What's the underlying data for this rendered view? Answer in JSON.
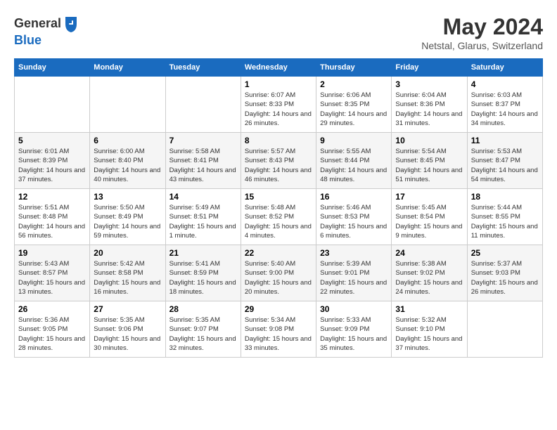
{
  "header": {
    "logo_line1": "General",
    "logo_line2": "Blue",
    "month": "May 2024",
    "location": "Netstal, Glarus, Switzerland"
  },
  "weekdays": [
    "Sunday",
    "Monday",
    "Tuesday",
    "Wednesday",
    "Thursday",
    "Friday",
    "Saturday"
  ],
  "weeks": [
    [
      {
        "day": "",
        "sunrise": "",
        "sunset": "",
        "daylight": ""
      },
      {
        "day": "",
        "sunrise": "",
        "sunset": "",
        "daylight": ""
      },
      {
        "day": "",
        "sunrise": "",
        "sunset": "",
        "daylight": ""
      },
      {
        "day": "1",
        "sunrise": "Sunrise: 6:07 AM",
        "sunset": "Sunset: 8:33 PM",
        "daylight": "Daylight: 14 hours and 26 minutes."
      },
      {
        "day": "2",
        "sunrise": "Sunrise: 6:06 AM",
        "sunset": "Sunset: 8:35 PM",
        "daylight": "Daylight: 14 hours and 29 minutes."
      },
      {
        "day": "3",
        "sunrise": "Sunrise: 6:04 AM",
        "sunset": "Sunset: 8:36 PM",
        "daylight": "Daylight: 14 hours and 31 minutes."
      },
      {
        "day": "4",
        "sunrise": "Sunrise: 6:03 AM",
        "sunset": "Sunset: 8:37 PM",
        "daylight": "Daylight: 14 hours and 34 minutes."
      }
    ],
    [
      {
        "day": "5",
        "sunrise": "Sunrise: 6:01 AM",
        "sunset": "Sunset: 8:39 PM",
        "daylight": "Daylight: 14 hours and 37 minutes."
      },
      {
        "day": "6",
        "sunrise": "Sunrise: 6:00 AM",
        "sunset": "Sunset: 8:40 PM",
        "daylight": "Daylight: 14 hours and 40 minutes."
      },
      {
        "day": "7",
        "sunrise": "Sunrise: 5:58 AM",
        "sunset": "Sunset: 8:41 PM",
        "daylight": "Daylight: 14 hours and 43 minutes."
      },
      {
        "day": "8",
        "sunrise": "Sunrise: 5:57 AM",
        "sunset": "Sunset: 8:43 PM",
        "daylight": "Daylight: 14 hours and 46 minutes."
      },
      {
        "day": "9",
        "sunrise": "Sunrise: 5:55 AM",
        "sunset": "Sunset: 8:44 PM",
        "daylight": "Daylight: 14 hours and 48 minutes."
      },
      {
        "day": "10",
        "sunrise": "Sunrise: 5:54 AM",
        "sunset": "Sunset: 8:45 PM",
        "daylight": "Daylight: 14 hours and 51 minutes."
      },
      {
        "day": "11",
        "sunrise": "Sunrise: 5:53 AM",
        "sunset": "Sunset: 8:47 PM",
        "daylight": "Daylight: 14 hours and 54 minutes."
      }
    ],
    [
      {
        "day": "12",
        "sunrise": "Sunrise: 5:51 AM",
        "sunset": "Sunset: 8:48 PM",
        "daylight": "Daylight: 14 hours and 56 minutes."
      },
      {
        "day": "13",
        "sunrise": "Sunrise: 5:50 AM",
        "sunset": "Sunset: 8:49 PM",
        "daylight": "Daylight: 14 hours and 59 minutes."
      },
      {
        "day": "14",
        "sunrise": "Sunrise: 5:49 AM",
        "sunset": "Sunset: 8:51 PM",
        "daylight": "Daylight: 15 hours and 1 minute."
      },
      {
        "day": "15",
        "sunrise": "Sunrise: 5:48 AM",
        "sunset": "Sunset: 8:52 PM",
        "daylight": "Daylight: 15 hours and 4 minutes."
      },
      {
        "day": "16",
        "sunrise": "Sunrise: 5:46 AM",
        "sunset": "Sunset: 8:53 PM",
        "daylight": "Daylight: 15 hours and 6 minutes."
      },
      {
        "day": "17",
        "sunrise": "Sunrise: 5:45 AM",
        "sunset": "Sunset: 8:54 PM",
        "daylight": "Daylight: 15 hours and 9 minutes."
      },
      {
        "day": "18",
        "sunrise": "Sunrise: 5:44 AM",
        "sunset": "Sunset: 8:55 PM",
        "daylight": "Daylight: 15 hours and 11 minutes."
      }
    ],
    [
      {
        "day": "19",
        "sunrise": "Sunrise: 5:43 AM",
        "sunset": "Sunset: 8:57 PM",
        "daylight": "Daylight: 15 hours and 13 minutes."
      },
      {
        "day": "20",
        "sunrise": "Sunrise: 5:42 AM",
        "sunset": "Sunset: 8:58 PM",
        "daylight": "Daylight: 15 hours and 16 minutes."
      },
      {
        "day": "21",
        "sunrise": "Sunrise: 5:41 AM",
        "sunset": "Sunset: 8:59 PM",
        "daylight": "Daylight: 15 hours and 18 minutes."
      },
      {
        "day": "22",
        "sunrise": "Sunrise: 5:40 AM",
        "sunset": "Sunset: 9:00 PM",
        "daylight": "Daylight: 15 hours and 20 minutes."
      },
      {
        "day": "23",
        "sunrise": "Sunrise: 5:39 AM",
        "sunset": "Sunset: 9:01 PM",
        "daylight": "Daylight: 15 hours and 22 minutes."
      },
      {
        "day": "24",
        "sunrise": "Sunrise: 5:38 AM",
        "sunset": "Sunset: 9:02 PM",
        "daylight": "Daylight: 15 hours and 24 minutes."
      },
      {
        "day": "25",
        "sunrise": "Sunrise: 5:37 AM",
        "sunset": "Sunset: 9:03 PM",
        "daylight": "Daylight: 15 hours and 26 minutes."
      }
    ],
    [
      {
        "day": "26",
        "sunrise": "Sunrise: 5:36 AM",
        "sunset": "Sunset: 9:05 PM",
        "daylight": "Daylight: 15 hours and 28 minutes."
      },
      {
        "day": "27",
        "sunrise": "Sunrise: 5:35 AM",
        "sunset": "Sunset: 9:06 PM",
        "daylight": "Daylight: 15 hours and 30 minutes."
      },
      {
        "day": "28",
        "sunrise": "Sunrise: 5:35 AM",
        "sunset": "Sunset: 9:07 PM",
        "daylight": "Daylight: 15 hours and 32 minutes."
      },
      {
        "day": "29",
        "sunrise": "Sunrise: 5:34 AM",
        "sunset": "Sunset: 9:08 PM",
        "daylight": "Daylight: 15 hours and 33 minutes."
      },
      {
        "day": "30",
        "sunrise": "Sunrise: 5:33 AM",
        "sunset": "Sunset: 9:09 PM",
        "daylight": "Daylight: 15 hours and 35 minutes."
      },
      {
        "day": "31",
        "sunrise": "Sunrise: 5:32 AM",
        "sunset": "Sunset: 9:10 PM",
        "daylight": "Daylight: 15 hours and 37 minutes."
      },
      {
        "day": "",
        "sunrise": "",
        "sunset": "",
        "daylight": ""
      }
    ]
  ]
}
